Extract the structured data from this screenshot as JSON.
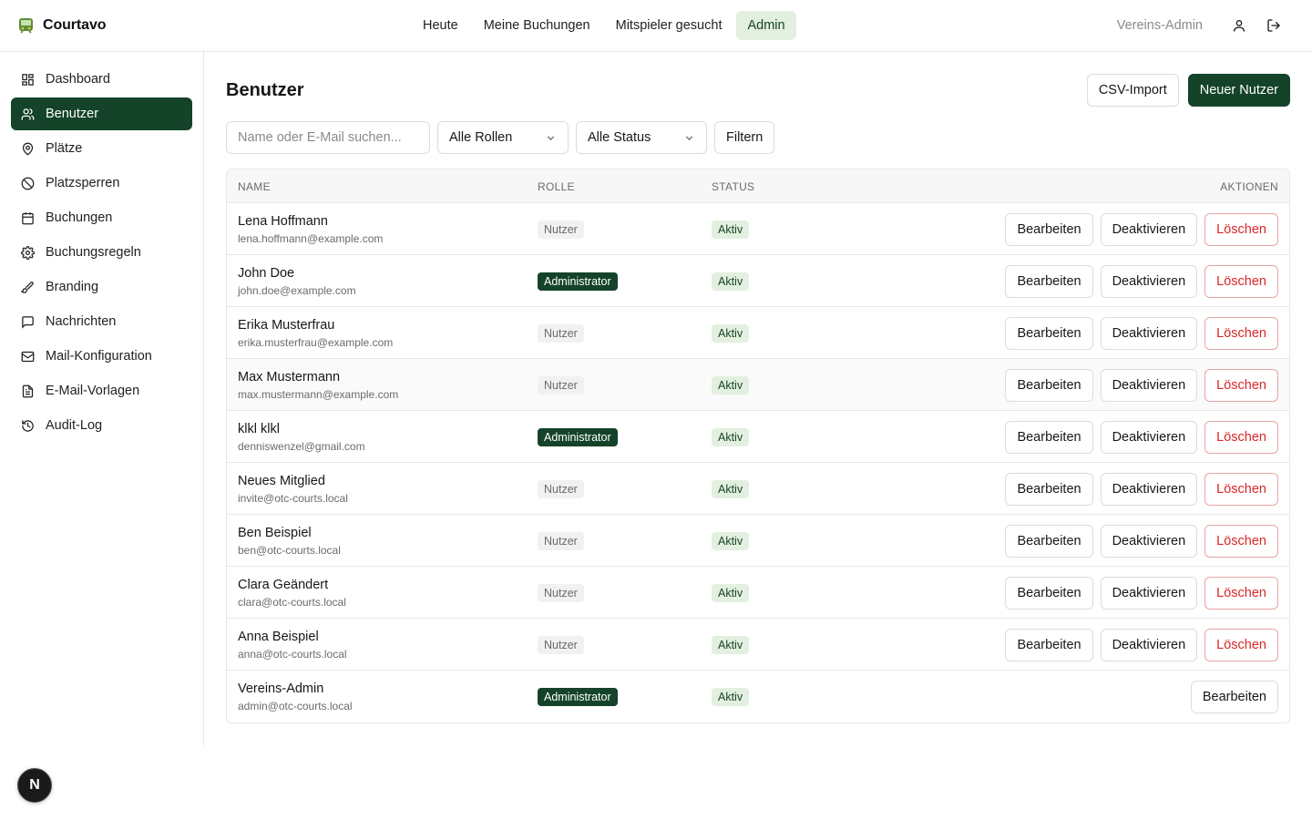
{
  "app": {
    "name": "Courtavo"
  },
  "topnav": {
    "items": [
      {
        "label": "Heute",
        "active": false
      },
      {
        "label": "Meine Buchungen",
        "active": false
      },
      {
        "label": "Mitspieler gesucht",
        "active": false
      },
      {
        "label": "Admin",
        "active": true
      }
    ],
    "role_label": "Vereins-Admin",
    "profile_icon": "user-icon",
    "logout_icon": "logout-icon"
  },
  "sidebar": {
    "items": [
      {
        "label": "Dashboard",
        "icon": "dashboard-icon",
        "active": false
      },
      {
        "label": "Benutzer",
        "icon": "users-icon",
        "active": true
      },
      {
        "label": "Plätze",
        "icon": "map-pin-icon",
        "active": false
      },
      {
        "label": "Platzsperren",
        "icon": "ban-icon",
        "active": false
      },
      {
        "label": "Buchungen",
        "icon": "calendar-icon",
        "active": false
      },
      {
        "label": "Buchungsregeln",
        "icon": "gear-icon",
        "active": false
      },
      {
        "label": "Branding",
        "icon": "brush-icon",
        "active": false
      },
      {
        "label": "Nachrichten",
        "icon": "message-icon",
        "active": false
      },
      {
        "label": "Mail-Konfiguration",
        "icon": "mail-icon",
        "active": false
      },
      {
        "label": "E-Mail-Vorlagen",
        "icon": "file-text-icon",
        "active": false
      },
      {
        "label": "Audit-Log",
        "icon": "history-icon",
        "active": false
      }
    ]
  },
  "page": {
    "title": "Benutzer",
    "csv_import": "CSV-Import",
    "new_user": "Neuer Nutzer"
  },
  "filters": {
    "search_placeholder": "Name oder E-Mail suchen...",
    "roles_value": "Alle Rollen",
    "status_value": "Alle Status",
    "filter_button": "Filtern"
  },
  "table": {
    "columns": {
      "name": "NAME",
      "role": "ROLLE",
      "status": "STATUS",
      "actions": "AKTIONEN"
    },
    "actions": {
      "edit": "Bearbeiten",
      "deactivate": "Deaktivieren",
      "delete": "Löschen"
    },
    "rows": [
      {
        "name": "Lena Hoffmann",
        "email": "lena.hoffmann@example.com",
        "role": "Nutzer",
        "status": "Aktiv"
      },
      {
        "name": "John Doe",
        "email": "john.doe@example.com",
        "role": "Administrator",
        "status": "Aktiv"
      },
      {
        "name": "Erika Musterfrau",
        "email": "erika.musterfrau@example.com",
        "role": "Nutzer",
        "status": "Aktiv"
      },
      {
        "name": "Max Mustermann",
        "email": "max.mustermann@example.com",
        "role": "Nutzer",
        "status": "Aktiv"
      },
      {
        "name": "klkl klkl",
        "email": "denniswenzel@gmail.com",
        "role": "Administrator",
        "status": "Aktiv"
      },
      {
        "name": "Neues Mitglied",
        "email": "invite@otc-courts.local",
        "role": "Nutzer",
        "status": "Aktiv"
      },
      {
        "name": "Ben Beispiel",
        "email": "ben@otc-courts.local",
        "role": "Nutzer",
        "status": "Aktiv"
      },
      {
        "name": "Clara Geändert",
        "email": "clara@otc-courts.local",
        "role": "Nutzer",
        "status": "Aktiv"
      },
      {
        "name": "Anna Beispiel",
        "email": "anna@otc-courts.local",
        "role": "Nutzer",
        "status": "Aktiv"
      },
      {
        "name": "Vereins-Admin",
        "email": "admin@otc-courts.local",
        "role": "Administrator",
        "status": "Aktiv"
      }
    ]
  },
  "dev_badge": {
    "label": "N"
  },
  "colors": {
    "primary": "#14432a",
    "accent_light": "#e3f0df",
    "danger": "#dc2626"
  }
}
